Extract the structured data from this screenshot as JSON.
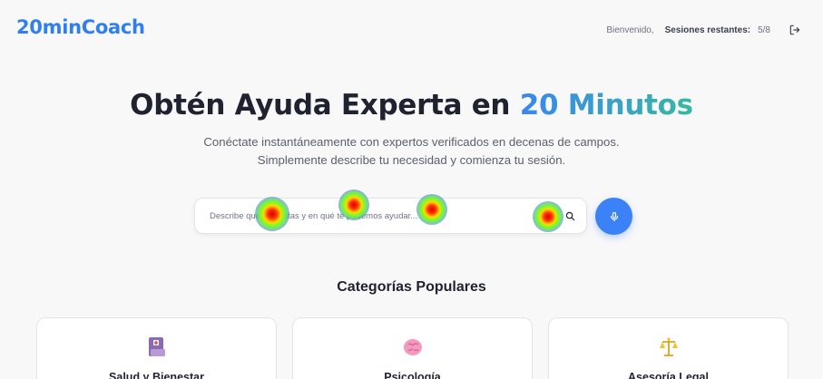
{
  "header": {
    "logo": "20minCoach",
    "welcome": "Bienvenido,",
    "sessions_label": "Sesiones restantes:",
    "sessions_value": "5/8"
  },
  "hero": {
    "title_main": "Obtén Ayuda Experta en ",
    "title_accent": "20 Minutos",
    "subtitle": "Conéctate instantáneamente con expertos verificados en decenas de campos. Simplemente describe tu necesidad y comienza tu sesión."
  },
  "search": {
    "placeholder": "Describe qué necesitas y en qué te podemos ayudar..."
  },
  "categories": {
    "title": "Categorías Populares",
    "items": [
      {
        "label": "Salud y Bienestar",
        "icon": "health-book-icon"
      },
      {
        "label": "Psicología",
        "icon": "brain-icon"
      },
      {
        "label": "Asesoría Legal",
        "icon": "scales-icon"
      }
    ]
  },
  "colors": {
    "brand": "#2f7ff0",
    "mic_button": "#3b82f6",
    "accent_gradient_start": "#3a86f0",
    "accent_gradient_end": "#38b8a0"
  }
}
